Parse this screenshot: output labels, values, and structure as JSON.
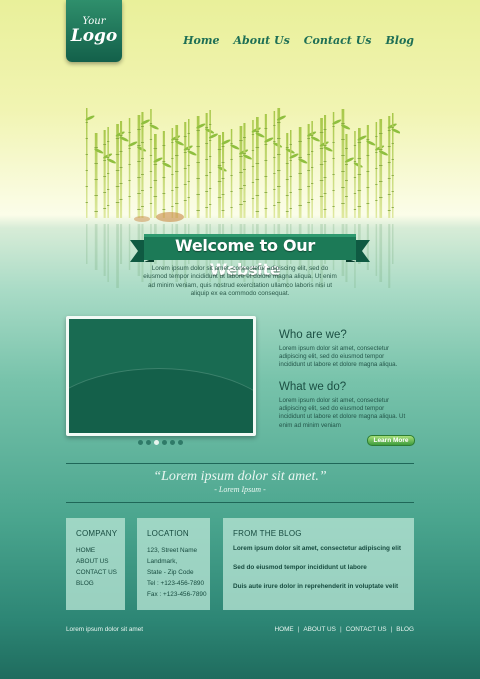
{
  "logo": {
    "line1": "Your",
    "line2": "Logo"
  },
  "nav": [
    "Home",
    "About Us",
    "Contact Us",
    "Blog"
  ],
  "hero": {
    "title": "Welcome to Our Website",
    "intro": "Lorem ipsum dolor sit amet, consectetur adipiscing elit, sed do eiusmod tempor incididunt ut labore et dolore magna aliqua. Ut enim ad minim veniam, quis nostrud exercitation ullamco laboris nisi ut aliquip ex ea commodo consequat."
  },
  "who": {
    "title": "Who are we?",
    "text": "Lorem ipsum dolor sit amet, consectetur adipiscing elit, sed do eiusmod tempor incididunt ut labore et dolore magna aliqua."
  },
  "what": {
    "title": "What we do?",
    "text": "Lorem ipsum dolor sit amet, consectetur adipiscing elit, sed do eiusmod tempor incididunt ut labore et dolore magna aliqua. Ut enim ad minim veniam",
    "button": "Learn More"
  },
  "slider": {
    "slides": 6,
    "active": 3
  },
  "quote": {
    "text": "“Lorem ipsum dolor sit amet.”",
    "author": "- Lorem Ipsum -"
  },
  "company": {
    "title": "COMPANY",
    "items": [
      "HOME",
      "ABOUT US",
      "CONTACT US",
      "BLOG"
    ]
  },
  "location": {
    "title": "LOCATION",
    "lines": [
      "123, Street Name",
      "Landmark,",
      "State - Zip Code",
      "Tel : +123-456-7890",
      "Fax : +123-456-7890"
    ]
  },
  "blog": {
    "title": "FROM THE BLOG",
    "items": [
      "Lorem ipsum dolor sit amet, consectetur adipiscing elit",
      "Sed do eiusmod tempor incididunt ut labore",
      "Duis aute irure dolor in reprehenderit in voluptate velit"
    ]
  },
  "footer": {
    "left": "Lorem ipsum dolor sit amet",
    "links": [
      "HOME",
      "ABOUT US",
      "CONTACT US",
      "BLOG"
    ]
  },
  "colors": {
    "accent": "#1e6f55",
    "ribbon": "#1c7a57",
    "button": "#3e9c3d"
  }
}
